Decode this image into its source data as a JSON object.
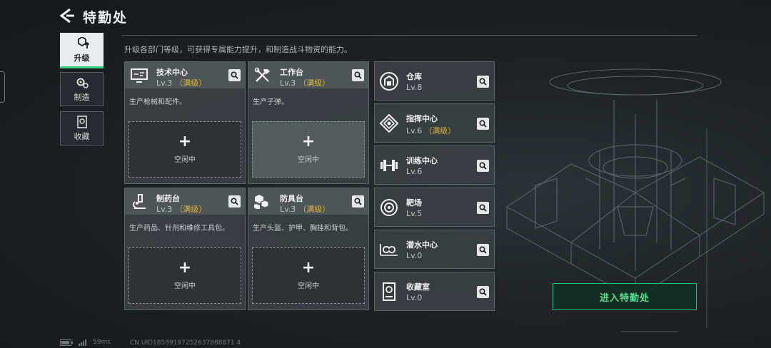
{
  "header": {
    "title": "特勤处"
  },
  "description": "升级各部门等级，可获得专属能力提升，和制造战斗物资的能力。",
  "tabs": [
    {
      "label": "升级",
      "icon": "upgrade-icon"
    },
    {
      "label": "制造",
      "icon": "gear-icon"
    },
    {
      "label": "收藏",
      "icon": "collection-icon"
    }
  ],
  "panels": [
    {
      "name": "技术中心",
      "level": "Lv.3",
      "max": "（满级）",
      "desc": "生产枪械和配件。",
      "slot_label": "空闲中",
      "icon": "monitor-icon"
    },
    {
      "name": "工作台",
      "level": "Lv.3",
      "max": "（满级）",
      "desc": "生产子弹。",
      "slot_label": "空闲中",
      "icon": "tools-icon"
    },
    {
      "name": "制药台",
      "level": "Lv.3",
      "max": "（满级）",
      "desc": "生产药品、针剂和维修工具包。",
      "slot_label": "空闲中",
      "icon": "microscope-icon"
    },
    {
      "name": "防具台",
      "level": "Lv.3",
      "max": "（满级）",
      "desc": "生产头盔、护甲、胸挂和背包。",
      "slot_label": "空闲中",
      "icon": "armor-icon"
    }
  ],
  "rooms": [
    {
      "name": "仓库",
      "level": "Lv.8",
      "max": "",
      "icon": "warehouse-icon"
    },
    {
      "name": "指挥中心",
      "level": "Lv.6",
      "max": "（满级）",
      "icon": "command-icon"
    },
    {
      "name": "训练中心",
      "level": "Lv.6",
      "max": "",
      "icon": "dumbbell-icon"
    },
    {
      "name": "靶场",
      "level": "Lv.5",
      "max": "",
      "icon": "target-icon"
    },
    {
      "name": "潜水中心",
      "level": "Lv.0",
      "max": "",
      "icon": "diving-icon"
    },
    {
      "name": "收藏室",
      "level": "Lv.0",
      "max": "",
      "icon": "collection-room-icon"
    }
  ],
  "enter_button": "进入特勤处",
  "footer": {
    "ping": "59ms",
    "uid": "CN UID18589197252637888871 4"
  },
  "colors": {
    "accent": "#37d07c",
    "max_level": "#e0b53a"
  }
}
